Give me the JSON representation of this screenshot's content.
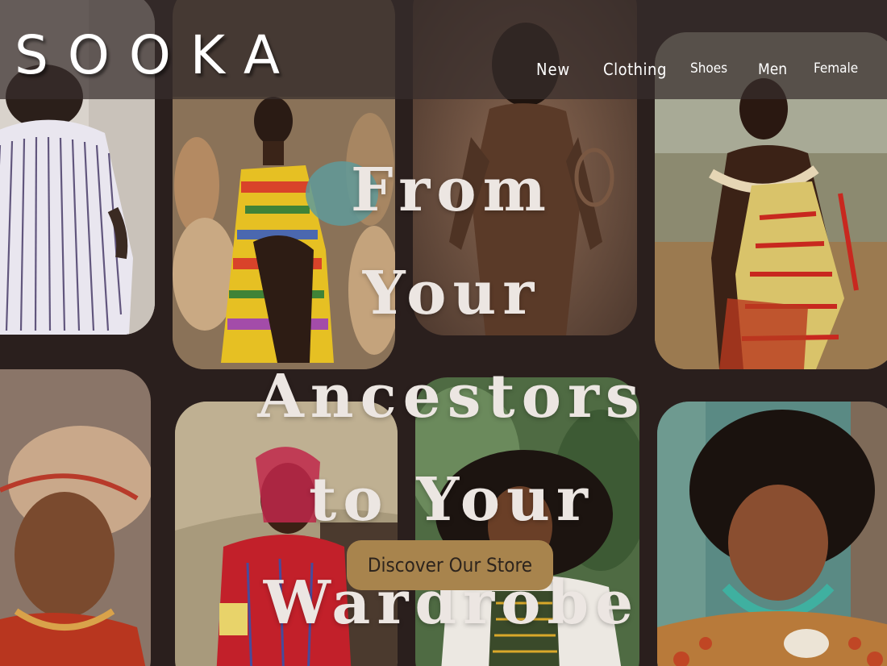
{
  "brand": {
    "logo": "SOOKA"
  },
  "nav": {
    "items": [
      {
        "label": "New"
      },
      {
        "label": "Clothing"
      },
      {
        "label": "Shoes"
      },
      {
        "label": "Men"
      },
      {
        "label": "Female"
      }
    ]
  },
  "hero": {
    "lines": [
      "From Your",
      "Ancestors",
      "to Your",
      "Wardrobe"
    ],
    "cta_label": "Discover Our Store"
  },
  "colors": {
    "background": "#2a1f1d",
    "topbar": "#382e2c",
    "cta": "#a8844d",
    "hero_text": "#ece6e2"
  },
  "gallery": {
    "photos": [
      {
        "subject": "man-striped-shirt-back"
      },
      {
        "subject": "woman-kente-dress-baskets"
      },
      {
        "subject": "woman-sepia-portrait"
      },
      {
        "subject": "woman-beaded-skirt"
      },
      {
        "subject": "person-headwrap"
      },
      {
        "subject": "man-red-beads-maasai"
      },
      {
        "subject": "woman-embroidered-dress"
      },
      {
        "subject": "woman-afro-turquoise-necklace"
      }
    ]
  }
}
